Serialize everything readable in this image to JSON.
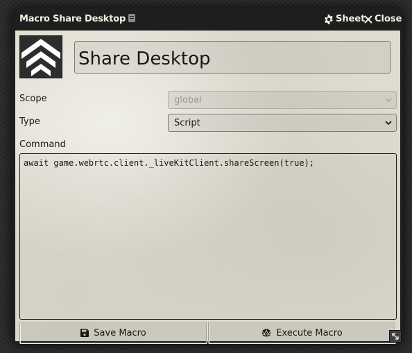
{
  "window": {
    "title": "Macro Share Desktop",
    "sheet_label": "Sheet",
    "close_label": "Close"
  },
  "icons": {
    "id_badge": "document-id-icon",
    "sheet": "gear-icon",
    "close": "close-icon",
    "macro_image": "triple-chevron-up-icon",
    "scope_dropdown": "chevron-down-icon",
    "type_dropdown": "chevron-down-icon",
    "save": "save-icon",
    "execute": "dice-d20-icon",
    "resize": "resize-arrows-icon"
  },
  "form": {
    "name_value": "Share Desktop",
    "scope_label": "Scope",
    "scope_value": "global",
    "type_label": "Type",
    "type_value": "Script",
    "command_label": "Command",
    "command_value": "await game.webrtc.client._liveKitClient.shareScreen(true);"
  },
  "footer": {
    "save_label": "Save Macro",
    "execute_label": "Execute Macro"
  },
  "colors": {
    "titlebar": "#1e1e1e",
    "title_text": "#f0f0e0",
    "parchment": "#dedcd0",
    "text": "#191813"
  }
}
